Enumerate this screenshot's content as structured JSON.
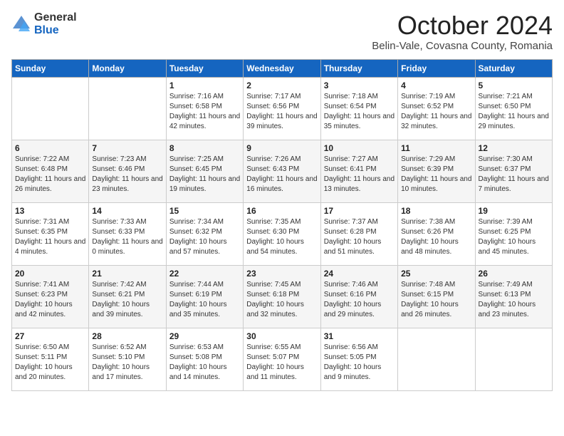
{
  "header": {
    "logo_general": "General",
    "logo_blue": "Blue",
    "month": "October 2024",
    "location": "Belin-Vale, Covasna County, Romania"
  },
  "columns": [
    "Sunday",
    "Monday",
    "Tuesday",
    "Wednesday",
    "Thursday",
    "Friday",
    "Saturday"
  ],
  "weeks": [
    [
      {
        "day": "",
        "info": ""
      },
      {
        "day": "",
        "info": ""
      },
      {
        "day": "1",
        "info": "Sunrise: 7:16 AM\nSunset: 6:58 PM\nDaylight: 11 hours and 42 minutes."
      },
      {
        "day": "2",
        "info": "Sunrise: 7:17 AM\nSunset: 6:56 PM\nDaylight: 11 hours and 39 minutes."
      },
      {
        "day": "3",
        "info": "Sunrise: 7:18 AM\nSunset: 6:54 PM\nDaylight: 11 hours and 35 minutes."
      },
      {
        "day": "4",
        "info": "Sunrise: 7:19 AM\nSunset: 6:52 PM\nDaylight: 11 hours and 32 minutes."
      },
      {
        "day": "5",
        "info": "Sunrise: 7:21 AM\nSunset: 6:50 PM\nDaylight: 11 hours and 29 minutes."
      }
    ],
    [
      {
        "day": "6",
        "info": "Sunrise: 7:22 AM\nSunset: 6:48 PM\nDaylight: 11 hours and 26 minutes."
      },
      {
        "day": "7",
        "info": "Sunrise: 7:23 AM\nSunset: 6:46 PM\nDaylight: 11 hours and 23 minutes."
      },
      {
        "day": "8",
        "info": "Sunrise: 7:25 AM\nSunset: 6:45 PM\nDaylight: 11 hours and 19 minutes."
      },
      {
        "day": "9",
        "info": "Sunrise: 7:26 AM\nSunset: 6:43 PM\nDaylight: 11 hours and 16 minutes."
      },
      {
        "day": "10",
        "info": "Sunrise: 7:27 AM\nSunset: 6:41 PM\nDaylight: 11 hours and 13 minutes."
      },
      {
        "day": "11",
        "info": "Sunrise: 7:29 AM\nSunset: 6:39 PM\nDaylight: 11 hours and 10 minutes."
      },
      {
        "day": "12",
        "info": "Sunrise: 7:30 AM\nSunset: 6:37 PM\nDaylight: 11 hours and 7 minutes."
      }
    ],
    [
      {
        "day": "13",
        "info": "Sunrise: 7:31 AM\nSunset: 6:35 PM\nDaylight: 11 hours and 4 minutes."
      },
      {
        "day": "14",
        "info": "Sunrise: 7:33 AM\nSunset: 6:33 PM\nDaylight: 11 hours and 0 minutes."
      },
      {
        "day": "15",
        "info": "Sunrise: 7:34 AM\nSunset: 6:32 PM\nDaylight: 10 hours and 57 minutes."
      },
      {
        "day": "16",
        "info": "Sunrise: 7:35 AM\nSunset: 6:30 PM\nDaylight: 10 hours and 54 minutes."
      },
      {
        "day": "17",
        "info": "Sunrise: 7:37 AM\nSunset: 6:28 PM\nDaylight: 10 hours and 51 minutes."
      },
      {
        "day": "18",
        "info": "Sunrise: 7:38 AM\nSunset: 6:26 PM\nDaylight: 10 hours and 48 minutes."
      },
      {
        "day": "19",
        "info": "Sunrise: 7:39 AM\nSunset: 6:25 PM\nDaylight: 10 hours and 45 minutes."
      }
    ],
    [
      {
        "day": "20",
        "info": "Sunrise: 7:41 AM\nSunset: 6:23 PM\nDaylight: 10 hours and 42 minutes."
      },
      {
        "day": "21",
        "info": "Sunrise: 7:42 AM\nSunset: 6:21 PM\nDaylight: 10 hours and 39 minutes."
      },
      {
        "day": "22",
        "info": "Sunrise: 7:44 AM\nSunset: 6:19 PM\nDaylight: 10 hours and 35 minutes."
      },
      {
        "day": "23",
        "info": "Sunrise: 7:45 AM\nSunset: 6:18 PM\nDaylight: 10 hours and 32 minutes."
      },
      {
        "day": "24",
        "info": "Sunrise: 7:46 AM\nSunset: 6:16 PM\nDaylight: 10 hours and 29 minutes."
      },
      {
        "day": "25",
        "info": "Sunrise: 7:48 AM\nSunset: 6:15 PM\nDaylight: 10 hours and 26 minutes."
      },
      {
        "day": "26",
        "info": "Sunrise: 7:49 AM\nSunset: 6:13 PM\nDaylight: 10 hours and 23 minutes."
      }
    ],
    [
      {
        "day": "27",
        "info": "Sunrise: 6:50 AM\nSunset: 5:11 PM\nDaylight: 10 hours and 20 minutes."
      },
      {
        "day": "28",
        "info": "Sunrise: 6:52 AM\nSunset: 5:10 PM\nDaylight: 10 hours and 17 minutes."
      },
      {
        "day": "29",
        "info": "Sunrise: 6:53 AM\nSunset: 5:08 PM\nDaylight: 10 hours and 14 minutes."
      },
      {
        "day": "30",
        "info": "Sunrise: 6:55 AM\nSunset: 5:07 PM\nDaylight: 10 hours and 11 minutes."
      },
      {
        "day": "31",
        "info": "Sunrise: 6:56 AM\nSunset: 5:05 PM\nDaylight: 10 hours and 9 minutes."
      },
      {
        "day": "",
        "info": ""
      },
      {
        "day": "",
        "info": ""
      }
    ]
  ]
}
